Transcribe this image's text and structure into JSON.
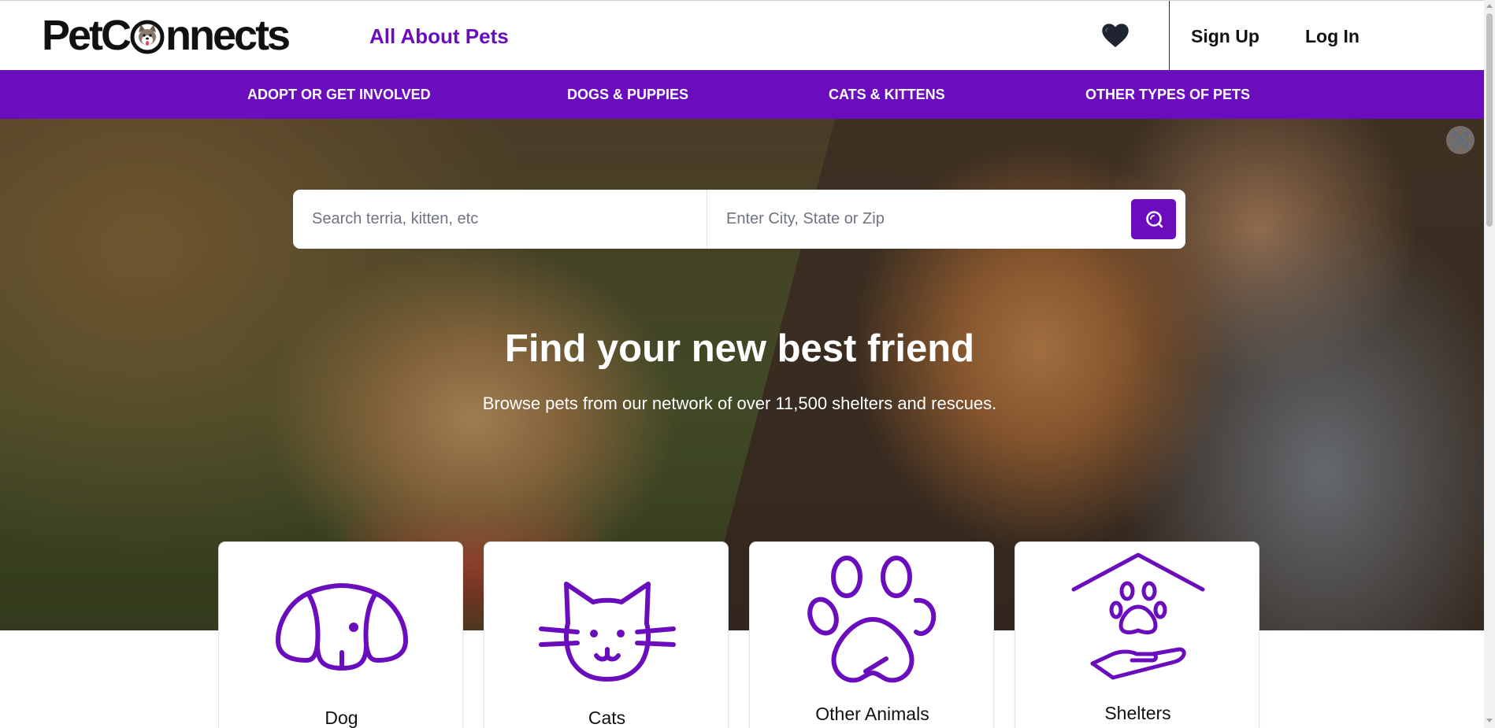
{
  "brand": {
    "logo_text_pre": "PetC",
    "logo_text_post": "nnects",
    "accent_color": "#6a0dbd"
  },
  "header": {
    "about_label": "All About Pets",
    "favorites_icon": "heart-icon",
    "signup_label": "Sign Up",
    "login_label": "Log In"
  },
  "nav": {
    "items": [
      {
        "label": "ADOPT OR GET INVOLVED"
      },
      {
        "label": "DOGS & PUPPIES"
      },
      {
        "label": "CATS & KITTENS"
      },
      {
        "label": "OTHER TYPES OF PETS"
      }
    ]
  },
  "hero": {
    "search_placeholder": "Search terria, kitten, etc",
    "location_placeholder": "Enter City, State or Zip",
    "title": "Find your new best friend",
    "subtitle": "Browse pets from our network of over 11,500 shelters and rescues."
  },
  "categories": [
    {
      "label": "Dog",
      "icon": "dog-icon"
    },
    {
      "label": "Cats",
      "icon": "cat-icon"
    },
    {
      "label": "Other Animals",
      "icon": "paw-icon"
    },
    {
      "label": "Shelters",
      "icon": "shelter-icon"
    }
  ]
}
